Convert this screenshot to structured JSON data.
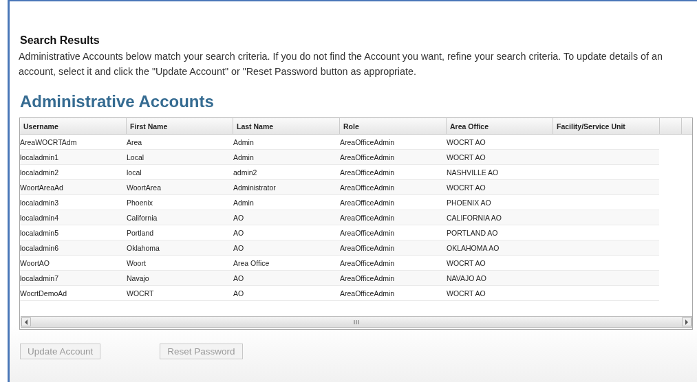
{
  "search_results": {
    "title": "Search Results",
    "description": "Administrative Accounts below match your search criteria. If you do not find the Account you want, refine your search criteria. To update details of an account, select it and click the \"Update Account\" or \"Reset Password button as appropriate."
  },
  "table": {
    "title": "Administrative Accounts",
    "columns": [
      "Username",
      "First Name",
      "Last Name",
      "Role",
      "Area Office",
      "Facility/Service Unit"
    ],
    "rows": [
      [
        "AreaWOCRTAdm",
        "Area",
        "Admin",
        "AreaOfficeAdmin",
        "WOCRT AO"
      ],
      [
        "localadmin1",
        "Local",
        "Admin",
        "AreaOfficeAdmin",
        "WOCRT AO"
      ],
      [
        "localadmin2",
        "local",
        "admin2",
        "AreaOfficeAdmin",
        "NASHVILLE AO"
      ],
      [
        "WoortAreaAd",
        "WoortArea",
        "Administrator",
        "AreaOfficeAdmin",
        "WOCRT AO"
      ],
      [
        "localadmin3",
        "Phoenix",
        "Admin",
        "AreaOfficeAdmin",
        "PHOENIX AO"
      ],
      [
        "localadmin4",
        "California",
        "AO",
        "AreaOfficeAdmin",
        "CALIFORNIA AO"
      ],
      [
        "localadmin5",
        "Portland",
        "AO",
        "AreaOfficeAdmin",
        "PORTLAND AO"
      ],
      [
        "localadmin6",
        "Oklahoma",
        "AO",
        "AreaOfficeAdmin",
        "OKLAHOMA AO"
      ],
      [
        "WoortAO",
        "Woort",
        "Area Office",
        "AreaOfficeAdmin",
        "WOCRT AO"
      ],
      [
        "localadmin7",
        "Navajo",
        "AO",
        "AreaOfficeAdmin",
        "NAVAJO AO"
      ],
      [
        "WocrtDemoAd",
        "WOCRT",
        "AO",
        "AreaOfficeAdmin",
        "WOCRT AO"
      ]
    ]
  },
  "buttons": [
    {
      "label": "Update Account",
      "disabled": true
    },
    {
      "label": "Reset Password",
      "disabled": true
    }
  ]
}
